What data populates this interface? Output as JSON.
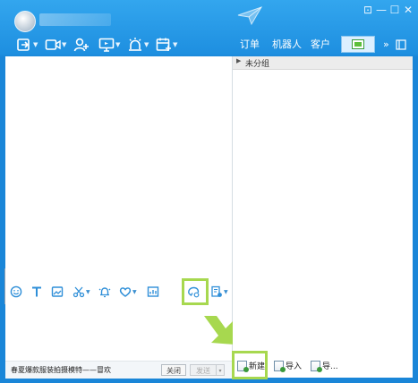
{
  "titlebar": {
    "contact_name": "████████ █",
    "window_controls": [
      "settings-icon",
      "minimize-icon",
      "maximize-icon",
      "close-icon"
    ]
  },
  "toolbar": {
    "tools": [
      "screen-share-icon",
      "video-icon",
      "add-user-icon",
      "remote-desktop-icon",
      "alarm-icon",
      "calendar-add-icon"
    ]
  },
  "nav": {
    "tabs": [
      "订单",
      "机器人",
      "客户"
    ],
    "more": "»"
  },
  "contacts": {
    "group_label": "未分组"
  },
  "input_toolbar": {
    "tools": [
      "emoji-icon",
      "font-icon",
      "image-icon",
      "scissors-icon",
      "bell-icon",
      "heart-icon",
      "chart-icon",
      "quick-reply-icon",
      "document-icon"
    ]
  },
  "bottom": {
    "promo_text": "春夏爆款服装拍摄模特——冒欢",
    "close_label": "关闭",
    "send_label": "发送",
    "send_dropdown": "▾"
  },
  "right_actions": {
    "new_label": "新建",
    "import_label": "导入",
    "export_label": "导..."
  },
  "colors": {
    "title_blue": "#1e8fe0",
    "highlight_green": "#a7d84f",
    "icon_blue": "#2f8fd8"
  }
}
